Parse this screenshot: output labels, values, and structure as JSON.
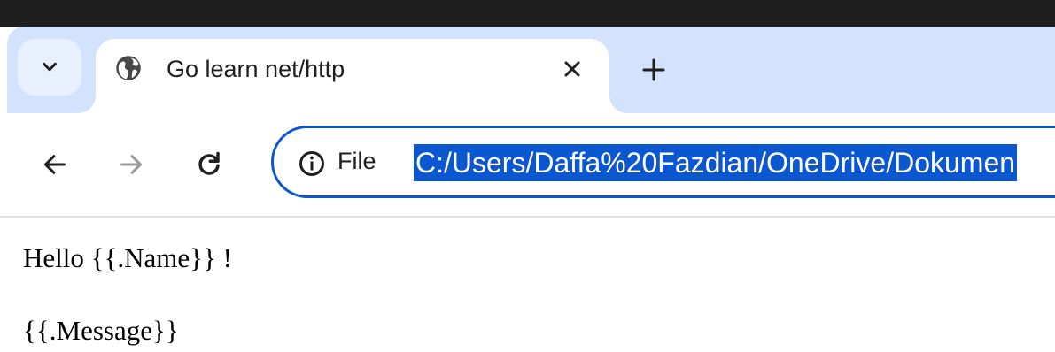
{
  "browser": {
    "tab": {
      "title": "Go learn net/http",
      "favicon": "globe-icon"
    },
    "tab_search_icon": "chevron-down-icon",
    "close_icon": "close-icon",
    "new_tab_icon": "plus-icon",
    "toolbar": {
      "back_icon": "arrow-left-icon",
      "forward_icon": "arrow-right-icon",
      "reload_icon": "reload-icon"
    },
    "address_bar": {
      "site_info_icon": "info-icon",
      "scheme_label": "File",
      "url": "C:/Users/Daffa%20Fazdian/OneDrive/Dokumen"
    },
    "colors": {
      "tabbar_bg": "#d3e3fd",
      "accent": "#0b57d0",
      "titlebar": "#1f1f1f"
    }
  },
  "page": {
    "line1": "Hello {{.Name}} !",
    "line2": "{{.Message}}"
  }
}
